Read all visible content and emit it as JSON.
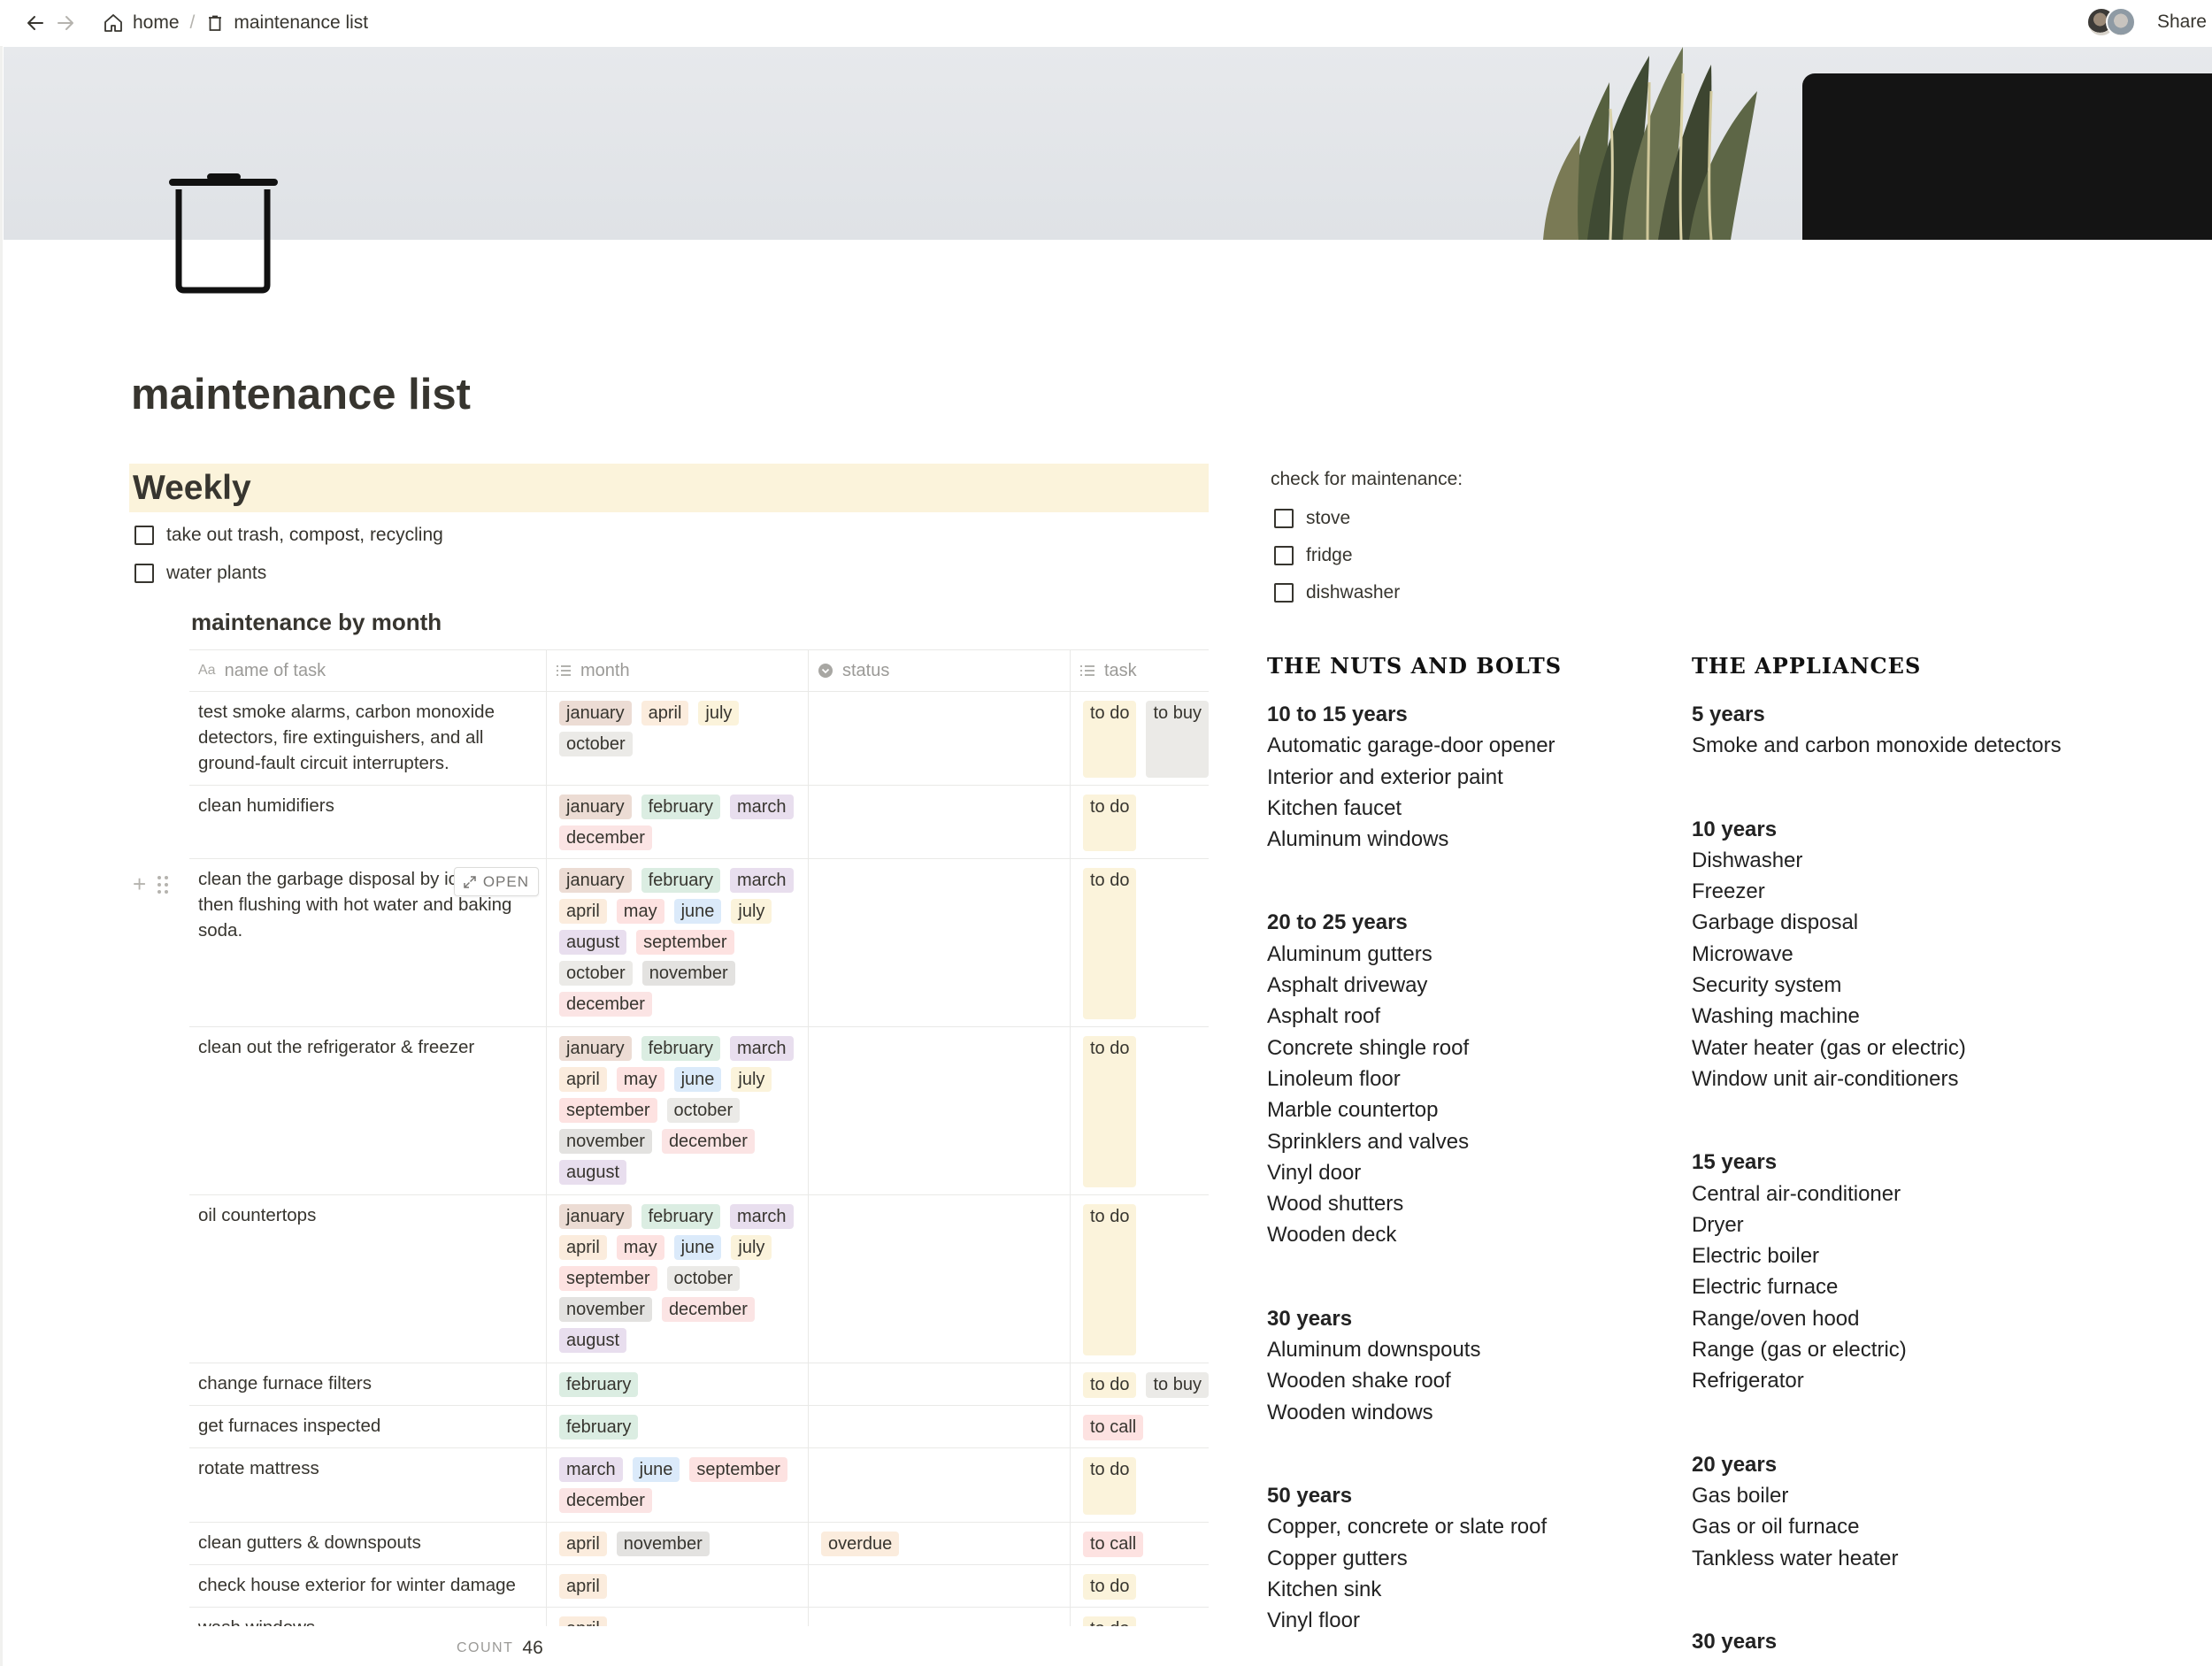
{
  "breadcrumb": {
    "home": "home",
    "separator": "/",
    "page": "maintenance list"
  },
  "topbar": {
    "share": "Share"
  },
  "page": {
    "title": "maintenance list"
  },
  "weekly": {
    "heading": "Weekly",
    "todos": [
      "take out trash, compost, recycling",
      "water plants"
    ]
  },
  "database": {
    "title": "maintenance by month",
    "columns": [
      "name of task",
      "month",
      "status",
      "task"
    ],
    "open_label": "OPEN",
    "count_label": "COUNT",
    "count": "46",
    "rows": [
      {
        "name": "test smoke alarms, carbon monoxide detectors, fire extinguishers, and all ground-fault circuit interrupters.",
        "months": [
          "january",
          "april",
          "july",
          "october"
        ],
        "status": [],
        "tasks": [
          "to do",
          "to buy"
        ]
      },
      {
        "name": "clean humidifiers",
        "months": [
          "january",
          "february",
          "march",
          "december"
        ],
        "status": [],
        "tasks": [
          "to do"
        ]
      },
      {
        "name": "clean the garbage disposal by ice cubes, then flushing with hot water and baking soda.",
        "months": [
          "january",
          "february",
          "march",
          "april",
          "may",
          "june",
          "july",
          "august",
          "september",
          "october",
          "november",
          "december"
        ],
        "status": [],
        "tasks": [
          "to do"
        ]
      },
      {
        "name": "clean out the refrigerator & freezer",
        "months": [
          "january",
          "february",
          "march",
          "april",
          "may",
          "june",
          "july",
          "september",
          "october",
          "november",
          "december",
          "august"
        ],
        "status": [],
        "tasks": [
          "to do"
        ]
      },
      {
        "name": "oil countertops",
        "months": [
          "january",
          "february",
          "march",
          "april",
          "may",
          "june",
          "july",
          "september",
          "october",
          "november",
          "december",
          "august"
        ],
        "status": [],
        "tasks": [
          "to do"
        ]
      },
      {
        "name": "change furnace filters",
        "months": [
          "february"
        ],
        "status": [],
        "tasks": [
          "to do",
          "to buy"
        ]
      },
      {
        "name": "get furnaces inspected",
        "months": [
          "february"
        ],
        "status": [],
        "tasks": [
          "to call"
        ]
      },
      {
        "name": "rotate mattress",
        "months": [
          "march",
          "june",
          "september",
          "december"
        ],
        "status": [],
        "tasks": [
          "to do"
        ]
      },
      {
        "name": "clean gutters & downspouts",
        "months": [
          "april",
          "november"
        ],
        "status": [
          "overdue"
        ],
        "tasks": [
          "to call"
        ]
      },
      {
        "name": "check house exterior for winter damage",
        "months": [
          "april"
        ],
        "status": [],
        "tasks": [
          "to do"
        ]
      },
      {
        "name": "wash windows",
        "months": [
          "april"
        ],
        "status": [],
        "tasks": [
          "to do"
        ]
      }
    ]
  },
  "tag_colors": {
    "january": "#ecdcd4",
    "february": "#dbede2",
    "march": "#e8deee",
    "april": "#fbecdd",
    "may": "#fde2e1",
    "june": "#dbeafa",
    "july": "#fbf3db",
    "august": "#e8deee",
    "september": "#fde2e1",
    "october": "#ebeae7",
    "november": "#e3e2e0",
    "december": "#fbe4e4",
    "to do": "#fbf3db",
    "to buy": "#ebeae7",
    "to call": "#fde2e1",
    "overdue": "#fbecdd"
  },
  "maintenance_check": {
    "heading": "check for maintenance:",
    "items": [
      "stove",
      "fridge",
      "dishwasher"
    ]
  },
  "nuts_and_bolts": {
    "heading": "THE NUTS AND BOLTS",
    "groups": [
      {
        "label": "10 to 15 years",
        "items": [
          "Automatic garage-door opener",
          "Interior and exterior paint",
          "Kitchen faucet",
          "Aluminum windows"
        ]
      },
      {
        "label": "20 to 25 years",
        "items": [
          "Aluminum gutters",
          "Asphalt driveway",
          "Asphalt roof",
          "Concrete shingle roof",
          "Linoleum floor",
          "Marble countertop",
          "Sprinklers and valves",
          "Vinyl door",
          "Wood shutters",
          "Wooden deck"
        ]
      },
      {
        "label": "30 years",
        "items": [
          "Aluminum downspouts",
          "Wooden shake roof",
          "Wooden windows"
        ]
      },
      {
        "label": "50 years",
        "items": [
          "Copper, concrete or slate roof",
          "Copper gutters",
          "Kitchen sink",
          "Vinyl floor"
        ]
      }
    ]
  },
  "appliances": {
    "heading": "THE APPLIANCES",
    "groups": [
      {
        "label": "5 years",
        "items": [
          "Smoke and carbon monoxide detectors"
        ]
      },
      {
        "label": "10 years",
        "items": [
          "Dishwasher",
          "Freezer",
          "Garbage disposal",
          "Microwave",
          "Security system",
          "Washing machine",
          "Water heater (gas or electric)",
          "Window unit air-conditioners"
        ]
      },
      {
        "label": "15 years",
        "items": [
          "Central air-conditioner",
          "Dryer",
          "Electric boiler",
          "Electric furnace",
          "Range/oven hood",
          "Range (gas or electric)",
          "Refrigerator"
        ]
      },
      {
        "label": "20 years",
        "items": [
          "Gas boiler",
          "Gas or oil furnace",
          "Tankless water heater"
        ]
      },
      {
        "label": "30 years",
        "items": []
      }
    ]
  }
}
